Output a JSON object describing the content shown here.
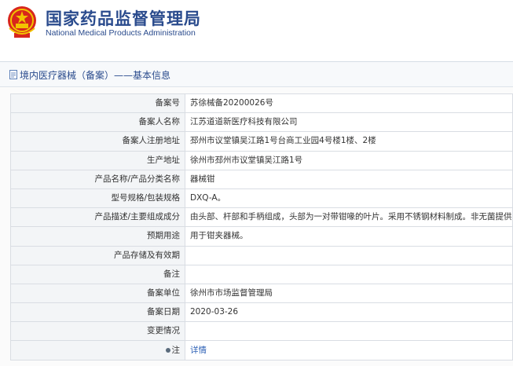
{
  "header": {
    "title_cn": "国家药品监督管理局",
    "title_en": "National Medical Products Administration"
  },
  "section": {
    "title": "境内医疗器械（备案）——基本信息"
  },
  "rows": [
    {
      "label": "备案号",
      "value": "苏徐械备20200026号"
    },
    {
      "label": "备案人名称",
      "value": "江苏道道新医疗科技有限公司"
    },
    {
      "label": "备案人注册地址",
      "value": "邳州市议堂镇吴江路1号台商工业园4号楼1楼、2楼"
    },
    {
      "label": "生产地址",
      "value": "徐州市邳州市议堂镇吴江路1号"
    },
    {
      "label": "产品名称/产品分类名称",
      "value": "器械钳"
    },
    {
      "label": "型号规格/包装规格",
      "value": "DXQ-A。"
    },
    {
      "label": "产品描述/主要组成成分",
      "value": "由头部、杆部和手柄组成，头部为一对带钳喙的叶片。采用不锈钢材料制成。非无菌提供。"
    },
    {
      "label": "预期用途",
      "value": "用于钳夹器械。"
    },
    {
      "label": "产品存储及有效期",
      "value": ""
    },
    {
      "label": "备注",
      "value": ""
    },
    {
      "label": "备案单位",
      "value": "徐州市市场监督管理局"
    },
    {
      "label": "备案日期",
      "value": "2020-03-26"
    },
    {
      "label": "变更情况",
      "value": ""
    },
    {
      "label": "注",
      "value": "详情"
    }
  ],
  "colors": {
    "brand_blue": "#2a4b8d",
    "link_blue": "#2f62b6",
    "label_bg": "#f3f5f7",
    "border": "#d9dde3"
  }
}
